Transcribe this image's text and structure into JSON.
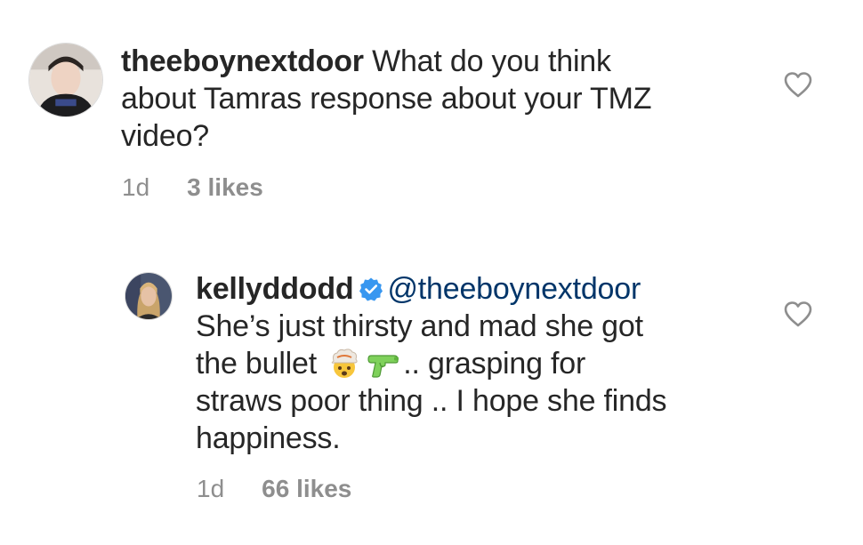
{
  "comments": [
    {
      "username": "theeboynextdoor",
      "text_line1": "What do you think",
      "text_line2": "about Tamras response about your TMZ",
      "text_line3": "video?",
      "time": "1d",
      "likes": "3 likes",
      "avatar_icon": "user-avatar"
    },
    {
      "username": "kellyddodd",
      "verified_icon": "verified-badge-icon",
      "mention": "@theeboynextdoor",
      "text_line1": "She’s just thirsty and mad she got",
      "text_line2_a": "the bullet",
      "emoji_1": "exploding-head-emoji",
      "emoji_2": "water-pistol-emoji",
      "text_line2_b": ".. grasping for",
      "text_line3": "straws poor thing .. I hope she finds",
      "text_line4": "happiness.",
      "time": "1d",
      "likes": "66 likes",
      "avatar_icon": "user-avatar"
    }
  ],
  "colors": {
    "text": "#262626",
    "meta": "#8e8e8e",
    "mention": "#003569",
    "verified": "#3897f0",
    "heart_outline": "#8e8e8e"
  }
}
